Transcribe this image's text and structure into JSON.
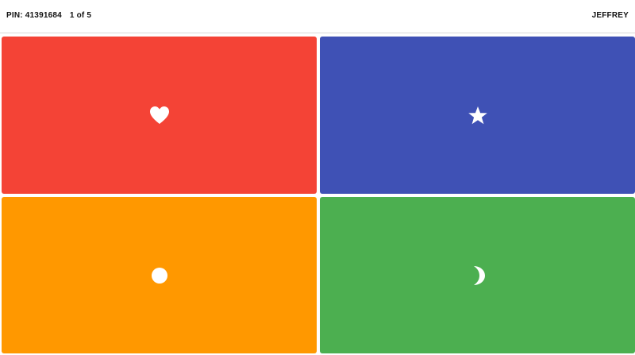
{
  "header": {
    "pin_label": "PIN: 41391684",
    "progress_label": "1 of 5",
    "player_name": "JEFFREY"
  },
  "answers": [
    {
      "shape": "heart-icon",
      "color": "#f44336"
    },
    {
      "shape": "star-icon",
      "color": "#3f51b5"
    },
    {
      "shape": "circle-icon",
      "color": "#ff9800"
    },
    {
      "shape": "moon-icon",
      "color": "#4caf50"
    }
  ]
}
